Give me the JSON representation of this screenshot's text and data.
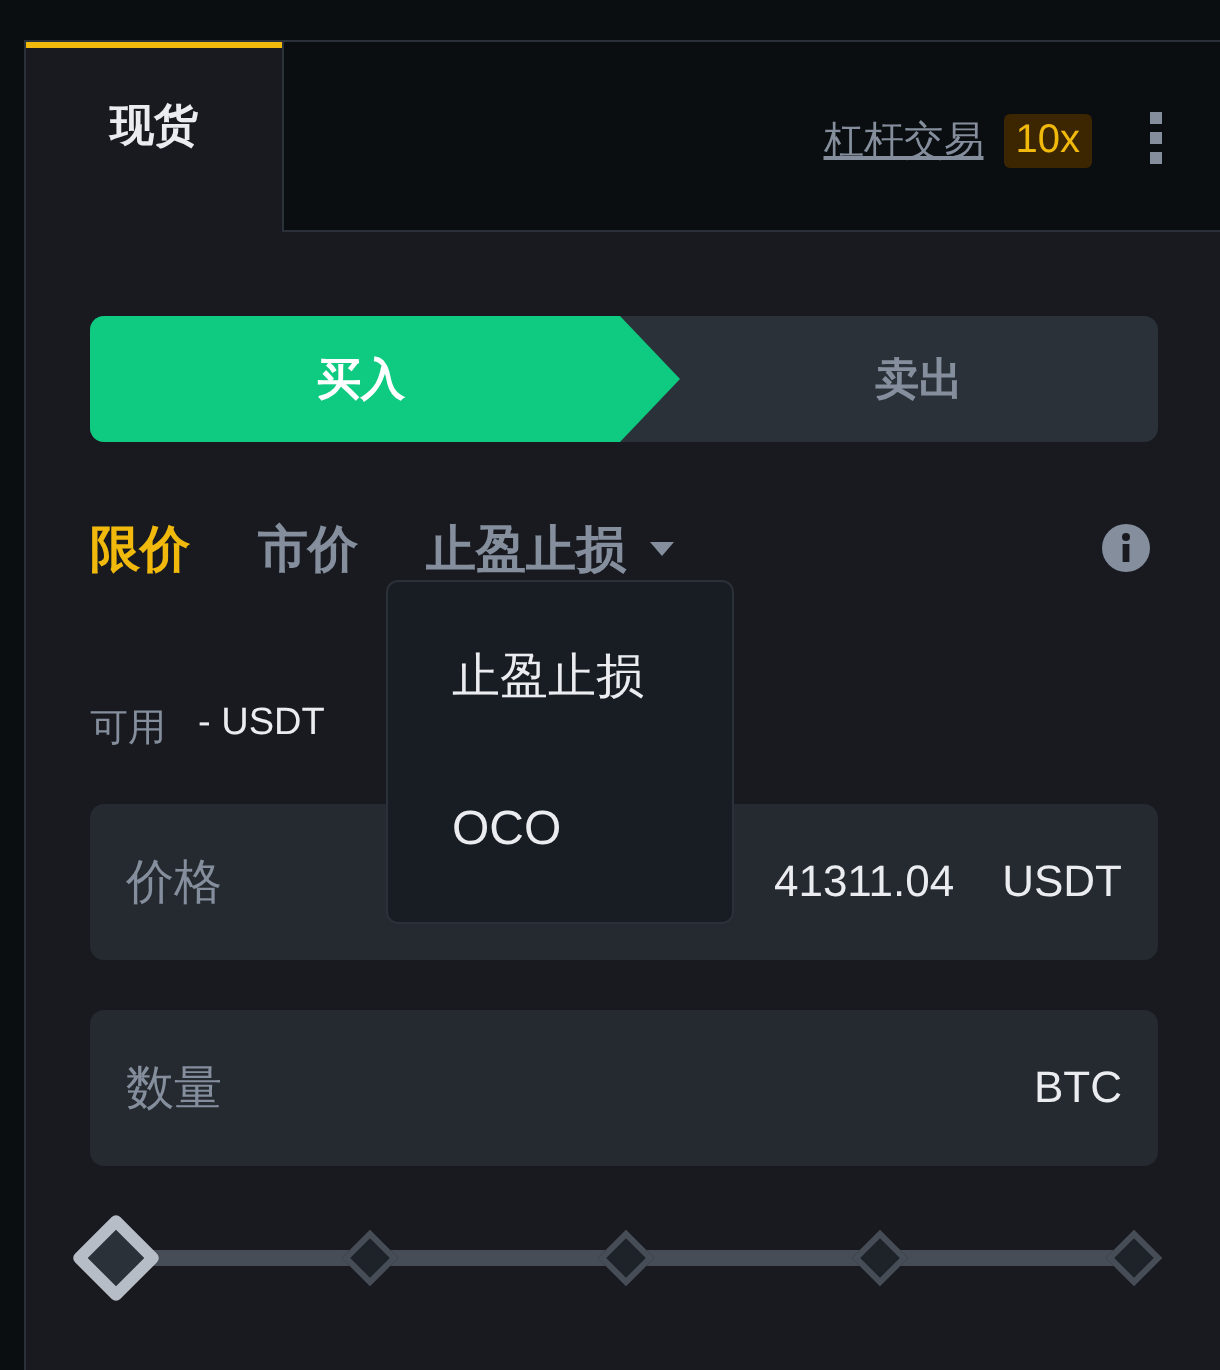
{
  "tabs": [
    {
      "label": "现货",
      "selected": true
    },
    {
      "label": "杠杆交易",
      "selected": false,
      "badge": "10x"
    }
  ],
  "side_toggle": [
    {
      "label": "买入",
      "selected": true
    },
    {
      "label": "卖出",
      "selected": false
    }
  ],
  "order_types": [
    {
      "label": "限价",
      "selected": true,
      "has_dropdown": false
    },
    {
      "label": "市价",
      "selected": false,
      "has_dropdown": false
    },
    {
      "label": "止盈止损",
      "selected": false,
      "has_dropdown": true
    }
  ],
  "dropdown_menu": {
    "items": [
      "止盈止损",
      "OCO"
    ]
  },
  "available": {
    "label": "可用",
    "value": "- USDT"
  },
  "fields": [
    {
      "label": "价格",
      "value": "41311.04",
      "unit": "USDT"
    },
    {
      "label": "数量",
      "unit": "BTC"
    }
  ],
  "slider": {
    "level": 0
  }
}
